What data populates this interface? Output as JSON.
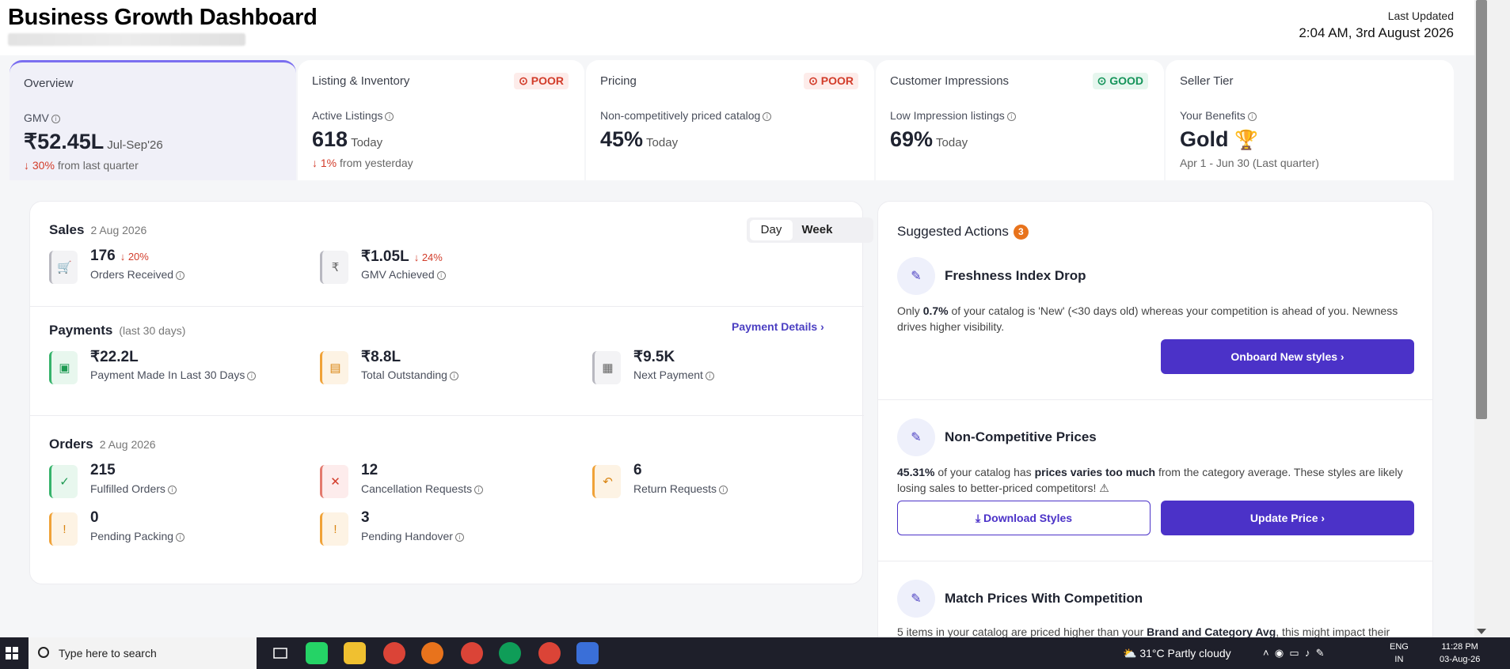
{
  "header": {
    "title": "Business Growth Dashboard",
    "updated_label": "Last Updated",
    "updated_value": "2:04 AM, 3rd August 2026"
  },
  "tabs": [
    {
      "name": "Overview",
      "metric_label": "GMV",
      "value": "₹52.45L",
      "suffix": "Jul-Sep'26",
      "sub_delta": "30%",
      "sub_text": "from last quarter"
    },
    {
      "name": "Listing & Inventory",
      "badge": "POOR",
      "metric_label": "Active Listings",
      "value": "618",
      "suffix": "Today",
      "sub_delta": "1%",
      "sub_text": "from yesterday"
    },
    {
      "name": "Pricing",
      "badge": "POOR",
      "metric_label": "Non-competitively priced catalog",
      "value": "45%",
      "suffix": "Today"
    },
    {
      "name": "Customer Impressions",
      "badge": "GOOD",
      "metric_label": "Low Impression listings",
      "value": "69%",
      "suffix": "Today"
    },
    {
      "name": "Seller Tier",
      "metric_label": "Your Benefits",
      "value": "Gold",
      "sub_text": "Apr 1 - Jun 30 (Last quarter)"
    }
  ],
  "sales": {
    "title": "Sales",
    "date": "2 Aug 2026",
    "toggle": {
      "day": "Day",
      "week": "Week"
    },
    "orders_value": "176",
    "orders_delta": "20%",
    "orders_label": "Orders Received",
    "gmv_value": "₹1.05L",
    "gmv_delta": "24%",
    "gmv_label": "GMV Achieved"
  },
  "payments": {
    "title": "Payments",
    "date": "(last 30 days)",
    "link": "Payment Details",
    "made_value": "₹22.2L",
    "made_label": "Payment Made In Last 30 Days",
    "outstanding_value": "₹8.8L",
    "outstanding_label": "Total Outstanding",
    "next_value": "₹9.5K",
    "next_label": "Next Payment"
  },
  "orders": {
    "title": "Orders",
    "date": "2 Aug 2026",
    "fulfilled_value": "215",
    "fulfilled_label": "Fulfilled Orders",
    "cancel_value": "12",
    "cancel_label": "Cancellation Requests",
    "return_value": "6",
    "return_label": "Return Requests",
    "packing_value": "0",
    "packing_label": "Pending Packing",
    "handover_value": "3",
    "handover_label": "Pending Handover"
  },
  "suggested": {
    "title": "Suggested Actions",
    "count": "3",
    "a1_title": "Freshness Index Drop",
    "a1_desc_pre": "Only ",
    "a1_desc_bold": "0.7%",
    "a1_desc_post": " of your catalog is 'New' (<30 days old) whereas your competition is ahead of you. Newness drives higher visibility.",
    "a1_btn": "Onboard New styles",
    "a2_title": "Non-Competitive Prices",
    "a2_bold1": "45.31%",
    "a2_mid": " of your catalog has ",
    "a2_bold2": "prices varies too much",
    "a2_post": " from the category average. These styles are likely losing sales to better-priced competitors! ⚠",
    "a2_btn_outline": "Download Styles",
    "a2_btn": "Update Price",
    "a3_title": "Match Prices With Competition",
    "a3_pre": "5 items in your catalog are priced higher than your ",
    "a3_bold": "Brand and Category Avg",
    "a3_post": ", this might impact their"
  },
  "taskbar": {
    "search_placeholder": "Type here to search",
    "weather": "31°C  Partly cloudy",
    "lang1": "ENG",
    "lang2": "IN",
    "time": "11:28 PM",
    "date": "03-Aug-26"
  }
}
